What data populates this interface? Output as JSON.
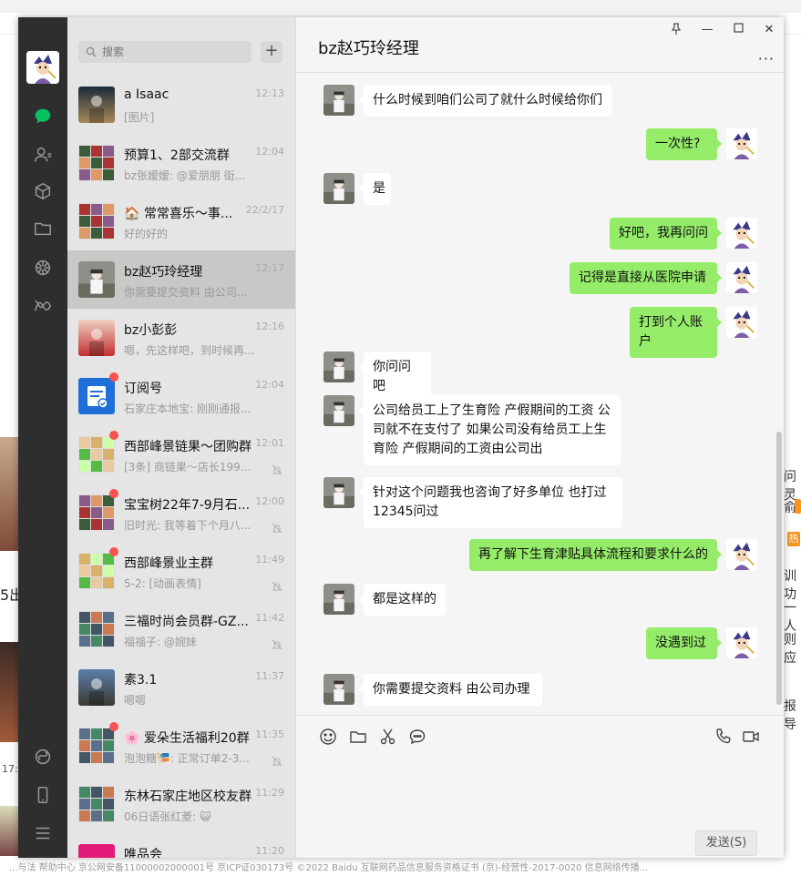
{
  "window": {
    "title": "bz赵巧玲经理"
  },
  "search": {
    "placeholder": "搜索"
  },
  "list_plus": "+",
  "chats": [
    {
      "name": "a  Isaac",
      "time": "12:13",
      "preview": "[图片]",
      "unread": false,
      "muted": false
    },
    {
      "name": "预算1、2部交流群",
      "time": "12:04",
      "preview": "bz张嫒嫒: @爱朋朋 街...",
      "unread": false,
      "muted": false
    },
    {
      "name": "🏠 常常喜乐～事...",
      "time": "22/2/17",
      "preview": "好的好的",
      "unread": false,
      "muted": false
    },
    {
      "name": "bz赵巧玲经理",
      "time": "12:17",
      "preview": "你需要提交资料  由公司...",
      "unread": false,
      "muted": false,
      "active": true
    },
    {
      "name": "bz小彭彭",
      "time": "12:16",
      "preview": "嗯，先这样吧，到时候再...",
      "unread": false,
      "muted": false
    },
    {
      "name": "订阅号",
      "time": "12:04",
      "preview": "石家庄本地宝: 刚刚通报...",
      "unread": true,
      "muted": false
    },
    {
      "name": "西部峰景链果～团购群",
      "time": "12:01",
      "preview": "[3条] 商链果～店长1993...",
      "unread": true,
      "muted": true
    },
    {
      "name": "宝宝树22年7-9月石...",
      "time": "12:00",
      "preview": "旧时光: 我等着下个月八...",
      "unread": true,
      "muted": true
    },
    {
      "name": "西部峰景业主群",
      "time": "11:49",
      "preview": "5-2: [动画表情]",
      "unread": true,
      "muted": true
    },
    {
      "name": "三福时尚会员群-GZ...",
      "time": "11:42",
      "preview": "福福子: @婉妹",
      "unread": false,
      "muted": true
    },
    {
      "name": "素3.1",
      "time": "11:37",
      "preview": "嗯嗯",
      "unread": false,
      "muted": false
    },
    {
      "name": "🌸 爱朵生活福利20群",
      "time": "11:35",
      "preview": "泡泡糖🎏: 正常订单2-3...",
      "unread": true,
      "muted": true
    },
    {
      "name": "东林石家庄地区校友群",
      "time": "11:29",
      "preview": "06日语张红菱: 😺",
      "unread": false,
      "muted": false
    },
    {
      "name": "唯品会",
      "time": "11:20",
      "preview": "",
      "unread": false,
      "muted": false
    }
  ],
  "messages": [
    {
      "side": "left",
      "text": "什么时候到咱们公司了就什么时候给你们"
    },
    {
      "side": "right",
      "text": "一次性?"
    },
    {
      "side": "left",
      "text": "是"
    },
    {
      "side": "right",
      "text": "好吧，我再问问"
    },
    {
      "side": "right",
      "text": "记得是直接从医院申请"
    },
    {
      "side": "right",
      "text": "打到个人账户"
    },
    {
      "side": "left",
      "text": "你问问吧"
    },
    {
      "side": "left",
      "text": "公司给员工上了生育险 产假期间的工资 公司就不在支付了  如果公司没有给员工上生育险 产假期间的工资由公司出"
    },
    {
      "side": "left",
      "text": "针对这个问题我也咨询了好多单位 也打过12345问过"
    },
    {
      "side": "right",
      "text": "再了解下生育津贴具体流程和要求什么的"
    },
    {
      "side": "left",
      "text": "都是这样的"
    },
    {
      "side": "right",
      "text": "没遇到过"
    },
    {
      "side": "left",
      "text": "你需要提交资料  由公司办理"
    }
  ],
  "input": {
    "send_label": "发送(S)"
  },
  "window_controls": {
    "pin": "🖈",
    "minimize": "—",
    "maximize": "☐",
    "close": "✕",
    "more": "···"
  },
  "background": {
    "right_texts": [
      "问灵",
      "俞",
      "训功",
      "一人",
      "则应",
      "报导"
    ],
    "hot_badge": "热",
    "left_texts": [
      "5出",
      "17:"
    ],
    "footer": "...与法    帮助中心    京公网安备11000002000001号    京ICP证030173号    ©2022 Baidu    互联网药品信息服务资格证书 (京)-经营性-2017-0020    信息网络传播..."
  },
  "colors": {
    "nav_bg": "#2e2e2e",
    "list_bg": "#e6e5e5",
    "active_bg": "#c9c8c7",
    "bubble_me": "#95ec69",
    "bubble_other": "#ffffff",
    "accent": "#07c160",
    "unread": "#fa5151"
  },
  "icons": [
    "chat-icon",
    "contacts-icon",
    "collections-icon",
    "files-icon",
    "moments-icon",
    "channels-icon",
    "mini-program-icon",
    "phone-icon",
    "menu-icon",
    "emoji-icon",
    "folder-icon",
    "scissors-icon",
    "bubble-icon",
    "call-icon",
    "video-icon"
  ]
}
